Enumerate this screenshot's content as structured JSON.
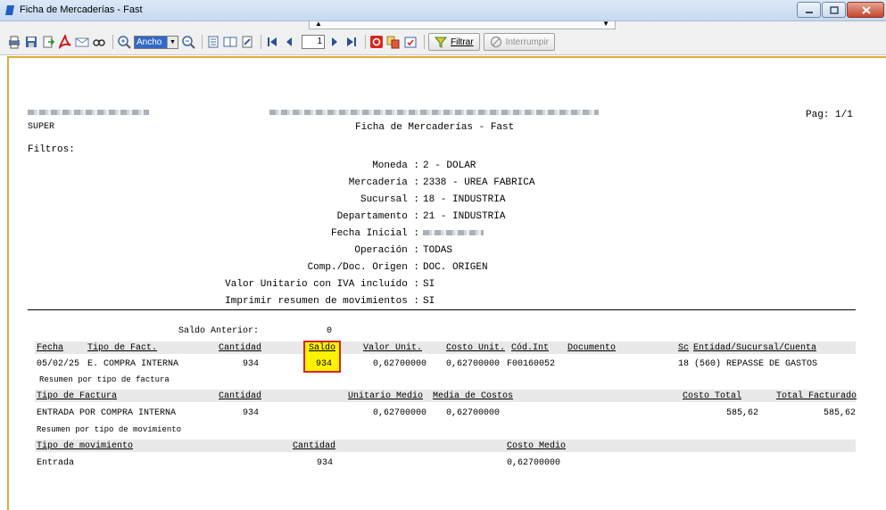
{
  "window": {
    "title": "Ficha de Mercaderías - Fast"
  },
  "toolbar": {
    "zoom_value": "Ancho",
    "page_number": "1",
    "filter_label": "Filtrar",
    "interrupt_label": "Interrumpir"
  },
  "report": {
    "company_left": "SUPER",
    "title": "Ficha de Mercaderías - Fast",
    "page": "Pag: 1/1",
    "filters_label": "Filtros:",
    "filters": [
      {
        "label": "Moneda :",
        "value": "2 - DOLAR"
      },
      {
        "label": "Mercadería :",
        "value": "2338 - UREA FABRICA"
      },
      {
        "label": "Sucursal :",
        "value": "18 - INDUSTRIA"
      },
      {
        "label": "Departamento :",
        "value": "21 - INDUSTRIA"
      },
      {
        "label": "Fecha Inicial :",
        "value": ""
      },
      {
        "label": "Operación :",
        "value": "TODAS"
      },
      {
        "label": "Comp./Doc. Origen :",
        "value": "DOC. ORIGEN"
      },
      {
        "label": "Valor Unitario con IVA incluído :",
        "value": "SI"
      },
      {
        "label": "Imprimir resumen de movimientos :",
        "value": "SI"
      }
    ],
    "saldo_anterior_label": "Saldo Anterior:",
    "saldo_anterior_value": "0",
    "movements": {
      "headers": {
        "fecha": "Fecha",
        "tipo": "Tipo de Fact.",
        "cantidad": "Cantidad",
        "saldo": "Saldo",
        "valor_unit": "Valor Unit.",
        "costo_unit": "Costo Unit.",
        "cod_int": "Cód.Int",
        "documento": "Documento",
        "sc": "Sc",
        "entidad": "Entidad/Sucursal/Cuenta"
      },
      "rows": [
        {
          "fecha": "05/02/25",
          "tipo": "E. COMPRA INTERNA",
          "cantidad": "934",
          "saldo": "934",
          "valor_unit": "0,62700000",
          "costo_unit": "0,62700000",
          "cod_int": "F00160052",
          "documento": "",
          "entidad": "18 (560) REPASSE DE GASTOS"
        }
      ]
    },
    "resumen_factura": {
      "title": "Resumen por tipo de factura",
      "headers": {
        "tipo": "Tipo de Factura",
        "cantidad": "Cantidad",
        "unitario_medio": "Unitario Medio",
        "media_costos": "Media de Costos",
        "costo_total": "Costo Total",
        "total_facturado": "Total Facturado"
      },
      "rows": [
        {
          "tipo": "ENTRADA POR COMPRA INTERNA",
          "cantidad": "934",
          "unitario_medio": "0,62700000",
          "media_costos": "0,62700000",
          "costo_total": "585,62",
          "total_facturado": "585,62"
        }
      ]
    },
    "resumen_movimiento": {
      "title": "Resumen por tipo de movimiento",
      "headers": {
        "tipo": "Tipo de movimiento",
        "cantidad": "Cantidad",
        "costo_medio": "Costo Medio"
      },
      "rows": [
        {
          "tipo": "Entrada",
          "cantidad": "934",
          "costo_medio": "0,62700000"
        }
      ]
    }
  },
  "colors": {
    "frame_border": "#e0a93a",
    "highlight_fill": "#fff200",
    "highlight_border": "#d8261d",
    "header_band": "#e8e8e8"
  }
}
